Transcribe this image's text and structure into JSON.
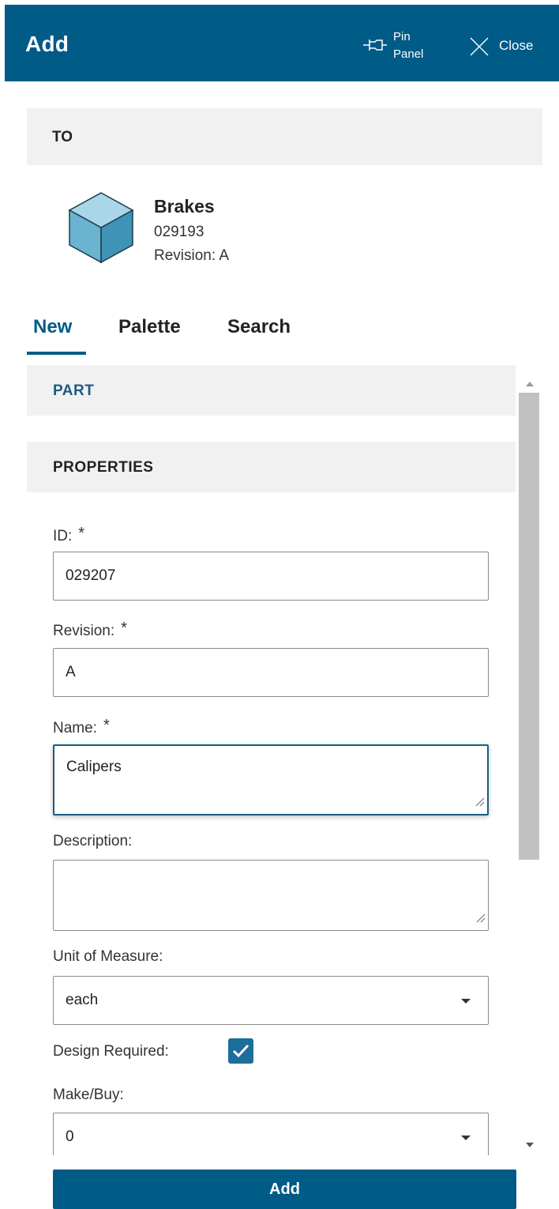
{
  "header": {
    "title": "Add",
    "pin_label_line1": "Pin",
    "pin_label_line2": "Panel",
    "close_label": "Close"
  },
  "to_section": {
    "label": "TO",
    "item_name": "Brakes",
    "item_number": "029193",
    "item_revision": "Revision:  A"
  },
  "tabs": [
    {
      "label": "New",
      "active": true
    },
    {
      "label": "Palette",
      "active": false
    },
    {
      "label": "Search",
      "active": false
    }
  ],
  "sections": {
    "part_label": "PART",
    "properties_label": "PROPERTIES"
  },
  "fields": {
    "id": {
      "label": "ID:",
      "required_marker": "*",
      "value": "029207"
    },
    "revision": {
      "label": "Revision:",
      "required_marker": "*",
      "value": "A"
    },
    "name": {
      "label": "Name:",
      "required_marker": "*",
      "value": "Calipers"
    },
    "description": {
      "label": "Description:",
      "value": ""
    },
    "unit_of_measure": {
      "label": "Unit of Measure:",
      "value": "each"
    },
    "design_required": {
      "label": "Design Required:",
      "checked": true
    },
    "make_buy": {
      "label": "Make/Buy:",
      "value": "0"
    }
  },
  "add_button_label": "Add",
  "colors": {
    "header_bg": "#005b86",
    "accent": "#005b86",
    "section_bg": "#f1f1f1",
    "checkbox_bg": "#1d6e9a"
  }
}
